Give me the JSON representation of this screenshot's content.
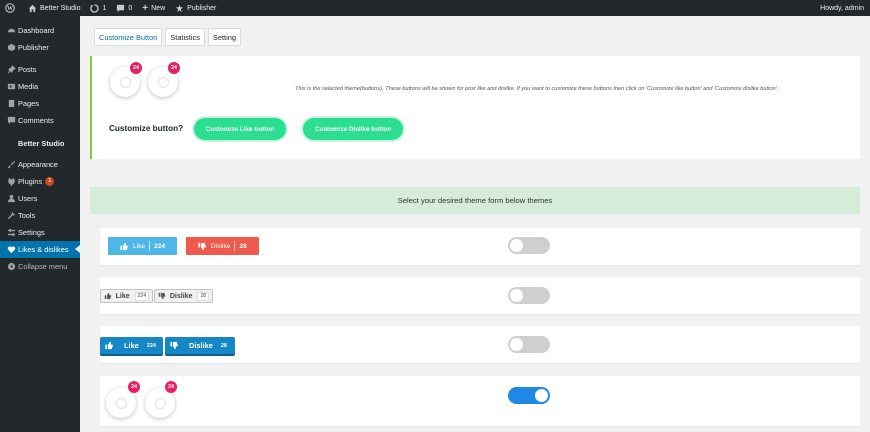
{
  "admin_bar": {
    "site_name": "Better Studio",
    "updates_count": "1",
    "comments_count": "0",
    "new_label": "New",
    "publisher_label": "Publisher",
    "howdy": "Howdy, admin"
  },
  "sidebar": {
    "items": [
      {
        "label": "Dashboard",
        "icon": "dashboard-icon"
      },
      {
        "label": "Publisher",
        "icon": "publisher-icon"
      },
      {
        "label": "Posts",
        "icon": "pin-icon"
      },
      {
        "label": "Media",
        "icon": "media-icon"
      },
      {
        "label": "Pages",
        "icon": "page-icon"
      },
      {
        "label": "Comments",
        "icon": "comment-icon"
      },
      {
        "label": "Better Studio",
        "icon": "none"
      },
      {
        "label": "Appearance",
        "icon": "brush-icon"
      },
      {
        "label": "Plugins",
        "icon": "plug-icon",
        "badge": "1"
      },
      {
        "label": "Users",
        "icon": "user-icon"
      },
      {
        "label": "Tools",
        "icon": "wrench-icon"
      },
      {
        "label": "Settings",
        "icon": "settings-icon"
      },
      {
        "label": "Likes & dislikes",
        "icon": "heart-icon"
      },
      {
        "label": "Collapse menu",
        "icon": "collapse-icon"
      }
    ]
  },
  "tabs": [
    {
      "label": "Customize Button"
    },
    {
      "label": "Statistics"
    },
    {
      "label": "Setting"
    }
  ],
  "selected_theme": {
    "like_count": "24",
    "dislike_count": "24",
    "description": "This is the selected theme(buttons). These buttons will be shown for post like and dislike. If you want to customize these buttons then click on 'Customize like button' and 'Customize dislike button'.",
    "customize_label": "Customize button?",
    "customize_like_label": "Customize Like button",
    "customize_dislike_label": "Customize Dislike button"
  },
  "themes_header": "Select your desired theme form below themes",
  "themes": [
    {
      "like_label": "Like",
      "like_count": "224",
      "dislike_label": "Dislike",
      "dislike_count": "28",
      "enabled": false
    },
    {
      "like_label": "Like",
      "like_count": "224",
      "dislike_label": "Dislike",
      "dislike_count": "28",
      "enabled": false
    },
    {
      "like_label": "Like",
      "like_count": "224",
      "dislike_label": "Dislike",
      "dislike_count": "28",
      "enabled": false
    },
    {
      "like_count": "24",
      "dislike_count": "24",
      "enabled": true
    }
  ],
  "colors": {
    "admin_bg": "#23282d",
    "active_menu": "#0073aa",
    "like_blue": "#4fb6e8",
    "dislike_red": "#ef5a4c",
    "theme3_blue": "#1586c6",
    "green_button": "#2bde90",
    "toggle_on": "#1e88e5",
    "badge_pink": "#e91e63"
  }
}
